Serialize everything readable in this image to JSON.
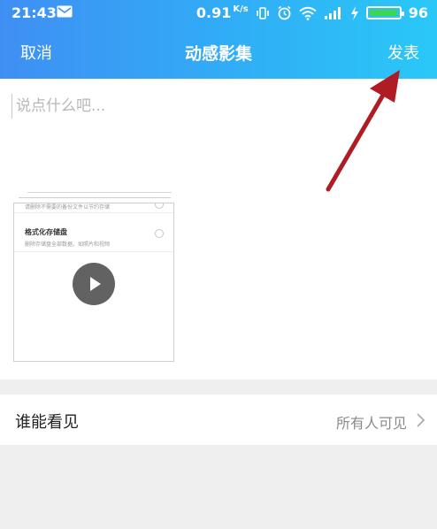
{
  "status_bar": {
    "time": "21:43",
    "speed": "0.91",
    "speed_unit": "K/s",
    "battery": "96",
    "battery_level": 0.96,
    "icons": [
      "message-icon",
      "vibrate-icon",
      "alarm-icon",
      "wifi-icon",
      "signal-icon",
      "charging-icon",
      "battery-icon"
    ]
  },
  "nav": {
    "cancel_label": "取消",
    "title": "动感影集",
    "publish_label": "发表"
  },
  "composer": {
    "placeholder": "说点什么吧...",
    "value": ""
  },
  "thumbnail": {
    "row0_text": "请删除不需要的备份文件以节约存储",
    "row1_title": "格式化存储盘",
    "row1_subtitle": "删除存储盘全部数据，如照片和视频"
  },
  "visibility": {
    "label": "谁能看见",
    "value": "所有人可见"
  },
  "colors": {
    "header_start": "#3f8ff3",
    "header_end": "#2ac8f7",
    "annotation_arrow": "#b01c24",
    "battery_fill": "#3cd653"
  }
}
